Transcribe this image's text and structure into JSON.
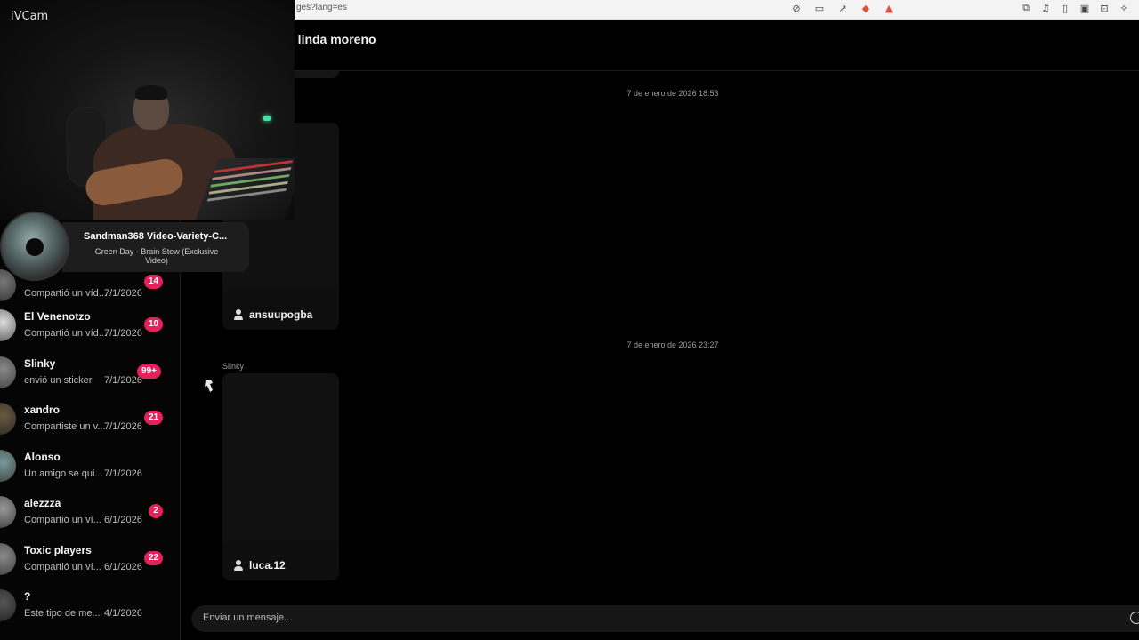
{
  "browser": {
    "url_fragment": "ges?lang=es"
  },
  "chat": {
    "title": "e linda moreno"
  },
  "messages": {
    "date_1": "7 de enero de 2026 18:53",
    "reel_1_author": "ansuupogba",
    "date_2": "7 de enero de 2026 23:27",
    "sender_2": "Slinky",
    "reel_2_author": "luca.12"
  },
  "composer": {
    "placeholder": "Enviar un mensaje..."
  },
  "sidebar": {
    "conversations": [
      {
        "name": "",
        "preview": "Compartió un víd...",
        "date": "7/1/2026",
        "badge": "14"
      },
      {
        "name": "El Venenotzo",
        "preview": "Compartió un víd...",
        "date": "7/1/2026",
        "badge": "10"
      },
      {
        "name": "Slinky",
        "preview": "envió un sticker",
        "date": "7/1/2026",
        "badge": "99+"
      },
      {
        "name": "xandro",
        "preview": "Compartiste un v...",
        "date": "7/1/2026",
        "badge": "21"
      },
      {
        "name": "Alonso",
        "preview": "Un amigo se qui...",
        "date": "7/1/2026",
        "badge": ""
      },
      {
        "name": "alezzza",
        "preview": "Compartió un ví...",
        "date": "6/1/2026",
        "badge": "2"
      },
      {
        "name": "Toxic players",
        "preview": "Compartió un ví...",
        "date": "6/1/2026",
        "badge": "22"
      },
      {
        "name": "?",
        "preview": "Este tipo de me...",
        "date": "4/1/2026",
        "badge": ""
      }
    ]
  },
  "overlay": {
    "camera_label": "iVCam",
    "now_playing_title": "Sandman368 Video-Variety-C...",
    "now_playing_subtitle": "Green Day - Brain Stew (Exclusive Video)"
  },
  "colors": {
    "badge": "#e4215a",
    "background": "#000000",
    "panel": "#1d1d1d"
  }
}
